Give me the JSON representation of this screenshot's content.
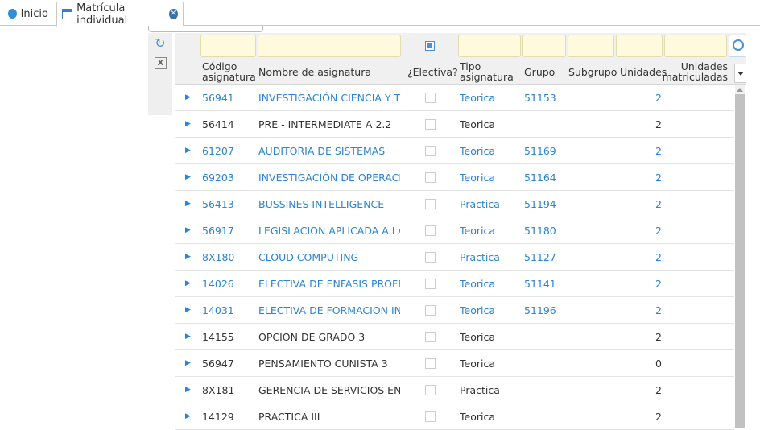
{
  "tabs": {
    "inicio": "Inicio",
    "matricula": "Matrícula individual"
  },
  "headers": {
    "codigo": "Código asignatura",
    "nombre": "Nombre de asignatura",
    "electiva": "¿Electiva?",
    "tipo": "Tipo asignatura",
    "grupo": "Grupo",
    "subgrupo": "Subgrupo",
    "unidades": "Unidades",
    "unidades_matriculadas": "Unidades matriculadas"
  },
  "rows": [
    {
      "codigo": "56941",
      "nombre": "INVESTIGACIÓN CIENCIA Y TECN",
      "tipo": "Teorica",
      "grupo": "51153",
      "unidades": "2",
      "linked": true
    },
    {
      "codigo": "56414",
      "nombre": "PRE - INTERMEDIATE A 2.2",
      "tipo": "Teorica",
      "grupo": "",
      "unidades": "2",
      "linked": false
    },
    {
      "codigo": "61207",
      "nombre": "AUDITORIA DE SISTEMAS",
      "tipo": "Teorica",
      "grupo": "51169",
      "unidades": "2",
      "linked": true
    },
    {
      "codigo": "69203",
      "nombre": "INVESTIGACIÓN DE OPERACION",
      "tipo": "Teorica",
      "grupo": "51164",
      "unidades": "2",
      "linked": true
    },
    {
      "codigo": "56413",
      "nombre": "BUSSINES INTELLIGENCE",
      "tipo": "Practica",
      "grupo": "51194",
      "unidades": "2",
      "linked": true
    },
    {
      "codigo": "56917",
      "nombre": "LEGISLACION APLICADA A LA IN",
      "tipo": "Teorica",
      "grupo": "51180",
      "unidades": "2",
      "linked": true
    },
    {
      "codigo": "8X180",
      "nombre": "CLOUD COMPUTING",
      "tipo": "Practica",
      "grupo": "51127",
      "unidades": "2",
      "linked": true
    },
    {
      "codigo": "14026",
      "nombre": "ELECTIVA DE ENFASIS PROFESIC",
      "tipo": "Teorica",
      "grupo": "51141",
      "unidades": "2",
      "linked": true
    },
    {
      "codigo": "14031",
      "nombre": "ELECTIVA DE FORMACION INTEG",
      "tipo": "Teorica",
      "grupo": "51196",
      "unidades": "2",
      "linked": true
    },
    {
      "codigo": "14155",
      "nombre": "OPCION DE GRADO 3",
      "tipo": "Teorica",
      "grupo": "",
      "unidades": "2",
      "linked": false
    },
    {
      "codigo": "56947",
      "nombre": "PENSAMIENTO CUNISTA 3",
      "tipo": "Teorica",
      "grupo": "",
      "unidades": "0",
      "linked": false
    },
    {
      "codigo": "8X181",
      "nombre": "GERENCIA DE SERVICIOS EN TEL",
      "tipo": "Practica",
      "grupo": "",
      "unidades": "2",
      "linked": false
    },
    {
      "codigo": "14129",
      "nombre": "PRACTICA III",
      "tipo": "Teorica",
      "grupo": "",
      "unidades": "2",
      "linked": false
    }
  ],
  "icons": {
    "refresh": "refresh-icon",
    "excel": "excel-export-icon",
    "search": "search-icon"
  },
  "colors": {
    "link": "#2a83d3",
    "filter_bg": "#fff9dd"
  }
}
